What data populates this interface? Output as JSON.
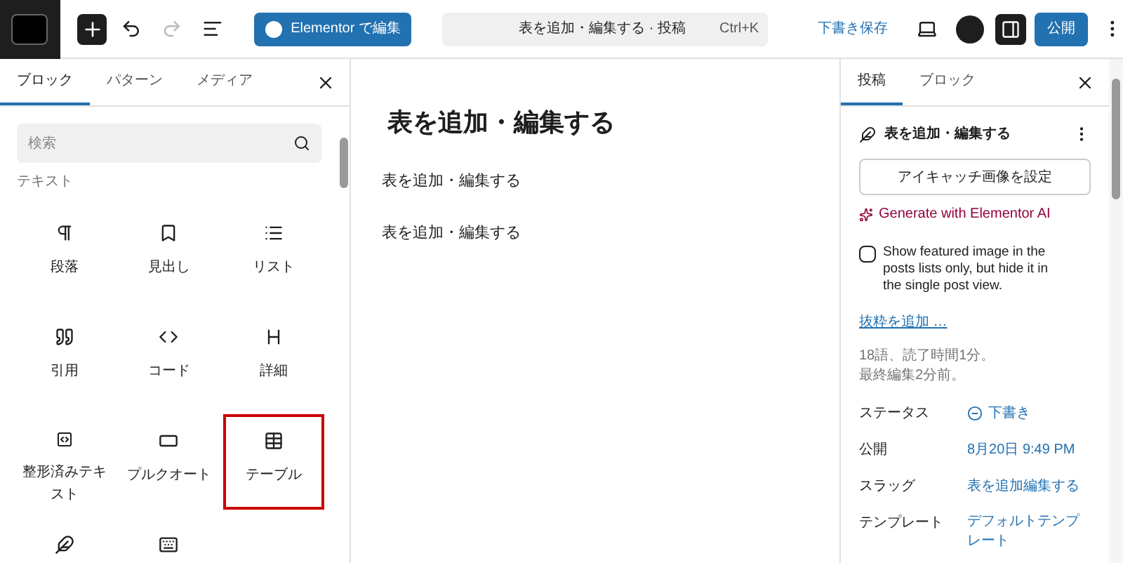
{
  "toolbar": {
    "elementor_button": "Elementor で編集",
    "command_bar": {
      "title": "表を追加・編集する · 投稿",
      "shortcut": "Ctrl+K"
    },
    "save_draft": "下書き保存",
    "publish": "公開"
  },
  "inserter": {
    "tabs": [
      {
        "label": "ブロック",
        "selected": true
      },
      {
        "label": "パターン",
        "selected": false
      },
      {
        "label": "メディア",
        "selected": false
      }
    ],
    "search": {
      "placeholder": "検索"
    },
    "category": "テキスト",
    "blocks": [
      {
        "kind": "paragraph",
        "label": "段落",
        "highlighted": false
      },
      {
        "kind": "heading",
        "label": "見出し",
        "highlighted": false
      },
      {
        "kind": "list",
        "label": "リスト",
        "highlighted": false
      },
      {
        "kind": "quote",
        "label": "引用",
        "highlighted": false
      },
      {
        "kind": "code",
        "label": "コード",
        "highlighted": false
      },
      {
        "kind": "details",
        "label": "詳細",
        "highlighted": false
      },
      {
        "kind": "preformatted",
        "label": "整形済みテキスト",
        "highlighted": false
      },
      {
        "kind": "pullquote",
        "label": "プルクオート",
        "highlighted": false
      },
      {
        "kind": "table",
        "label": "テーブル",
        "highlighted": true
      },
      {
        "kind": "verse",
        "highlighted": false
      },
      {
        "kind": "keyboard",
        "highlighted": false
      }
    ]
  },
  "editor": {
    "title": "表を追加・編集する",
    "paragraphs": [
      "表を追加・編集する",
      "表を追加・編集する"
    ]
  },
  "settings": {
    "tabs": [
      {
        "label": "投稿",
        "selected": true
      },
      {
        "label": "ブロック",
        "selected": false
      }
    ],
    "post_title": "表を追加・編集する",
    "featured_image_button": "アイキャッチ画像を設定",
    "ai_link": "Generate with Elementor AI",
    "featured_checkbox": {
      "label": "Show featured image in the posts lists only, but hide it in the single post view.",
      "checked": false
    },
    "excerpt_link": "抜粋を追加 …",
    "stats": [
      "18語、読了時間1分。",
      "最終編集2分前。"
    ],
    "fields": [
      {
        "label": "ステータス",
        "value": "下書き",
        "kind": "status"
      },
      {
        "label": "公開",
        "value": "8月20日 9:49 PM",
        "kind": "link"
      },
      {
        "label": "スラッグ",
        "value": "表を追加編集する",
        "kind": "link"
      },
      {
        "label": "テンプレート",
        "value": "デフォルトテンプレート",
        "kind": "link"
      }
    ]
  }
}
